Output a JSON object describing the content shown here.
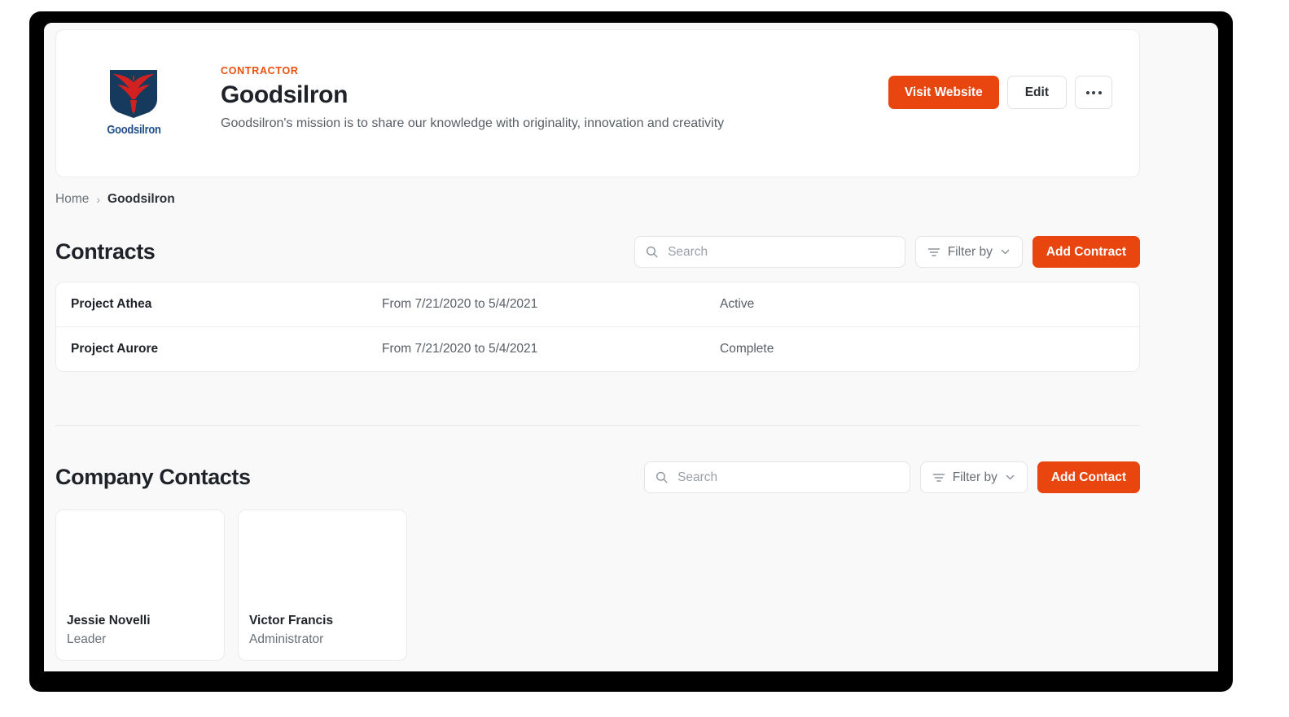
{
  "company": {
    "eyebrow": "CONTRACTOR",
    "name": "Goodsilron",
    "mission": "Goodsilron's mission is to share our knowledge with originality, innovation and creativity",
    "logo_wordmark": "Goodsilron",
    "logo_navy": "#16395e",
    "logo_red": "#d32020",
    "logo_text_color": "#1f4e88"
  },
  "header_actions": {
    "visit_website": "Visit Website",
    "edit": "Edit",
    "more_menu": "More options"
  },
  "breadcrumb": {
    "home": "Home",
    "separator": "›",
    "current": "Goodsilron"
  },
  "contracts": {
    "title": "Contracts",
    "search_placeholder": "Search",
    "search_value": "",
    "filter_label": "Filter by",
    "add_label": "Add Contract",
    "rows": [
      {
        "name": "Project Athea",
        "dates": "From 7/21/2020 to 5/4/2021",
        "status": "Active"
      },
      {
        "name": "Project Aurore",
        "dates": "From 7/21/2020 to 5/4/2021",
        "status": "Complete"
      }
    ]
  },
  "contacts": {
    "title": "Company Contacts",
    "search_placeholder": "Search",
    "search_value": "",
    "filter_label": "Filter by",
    "add_label": "Add Contact",
    "cards": [
      {
        "name": "Jessie Novelli",
        "role": "Leader"
      },
      {
        "name": "Victor Francis",
        "role": "Administrator"
      }
    ]
  },
  "theme": {
    "accent": "#e8450f",
    "page_bg": "#f9f9f9",
    "card_bg": "#ffffff"
  }
}
